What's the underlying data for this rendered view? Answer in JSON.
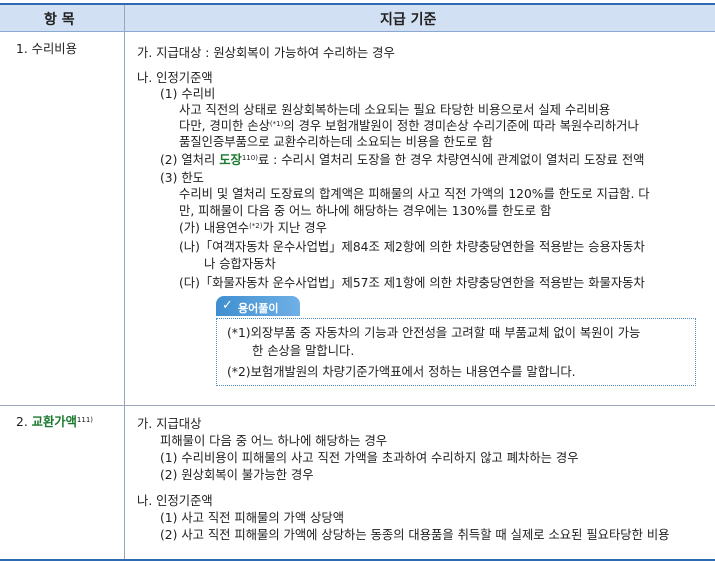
{
  "header": {
    "col1": "항 목",
    "col2": "지급 기준"
  },
  "row1": {
    "item": "1. 수리비용",
    "lines": {
      "a": "가. 지급대상 : 원상회복이 가능하여 수리하는 경우",
      "b": "나. 인정기준액",
      "b1": "(1) 수리비",
      "b1_t1": "사고 직전의 상태로 원상회복하는데 소요되는 필요 타당한 비용으로서 실제 수리비용",
      "b1_t2a": "다만, 경미한 손상",
      "b1_t2sup": "(*1)",
      "b1_t2b": "의 경우 보험개발원이 정한 경미손상 수리기준에 따라 복원수리하거나",
      "b1_t3": "품질인증부품으로 교환수리하는데 소요되는 비용을 한도로 함",
      "b2a": "(2) 열처리 ",
      "b2b": "도장",
      "b2sup": "110)",
      "b2c": "료 : 수리시 열처리 도장을 한 경우 차량연식에 관계없이 열처리 도장료 전액",
      "b3": "(3) 한도",
      "b3_t1": "수리비 및 열처리 도장료의 합계액은 피해물의 사고 직전 가액의 120%를 한도로 지급함. 다",
      "b3_t2": "만, 피해물이 다음 중 어느 하나에 해당하는 경우에는 130%를 한도로 함",
      "ga_a": "(가) 내용연수",
      "ga_sup": "(*2)",
      "ga_b": "가 지난 경우",
      "na1": "(나)「여객자동차 운수사업법」제84조 제2항에 의한 차량충당연한을 적용받는 승용자동차",
      "na2": "나 승합자동차",
      "da": "(다)「화물자동차 운수사업법」제57조 제1항에 의한 차량충당연한을 적용받는 화물자동차"
    },
    "note": {
      "tag": "용어풀이",
      "n1a": "(*1)외장부품 중 자동차의 기능과 안전성을 고려할 때 부품교체 없이 복원이 가능",
      "n1b": "한 손상을 말합니다.",
      "n2": "(*2)보험개발원의  차량기준가액표에서 정하는 내용연수를 말합니다."
    }
  },
  "row2": {
    "item_prefix": "2. ",
    "item_bold": "교환가액",
    "item_sup": "111)",
    "lines": {
      "a": "가. 지급대상",
      "a_t": "피해물이 다음 중 어느 하나에 해당하는 경우",
      "a1": "(1) 수리비용이 피해물의 사고 직전 가액을 초과하여 수리하지 않고 폐차하는 경우",
      "a2": "(2) 원상회복이 불가능한 경우",
      "b": "나. 인정기준액",
      "b1": "(1) 사고 직전 피해물의 가액 상당액",
      "b2": "(2) 사고 직전 피해물의 가액에 상당하는 동종의 대용품을 취득할 때 실제로 소요된 필요타당한 비용"
    }
  }
}
